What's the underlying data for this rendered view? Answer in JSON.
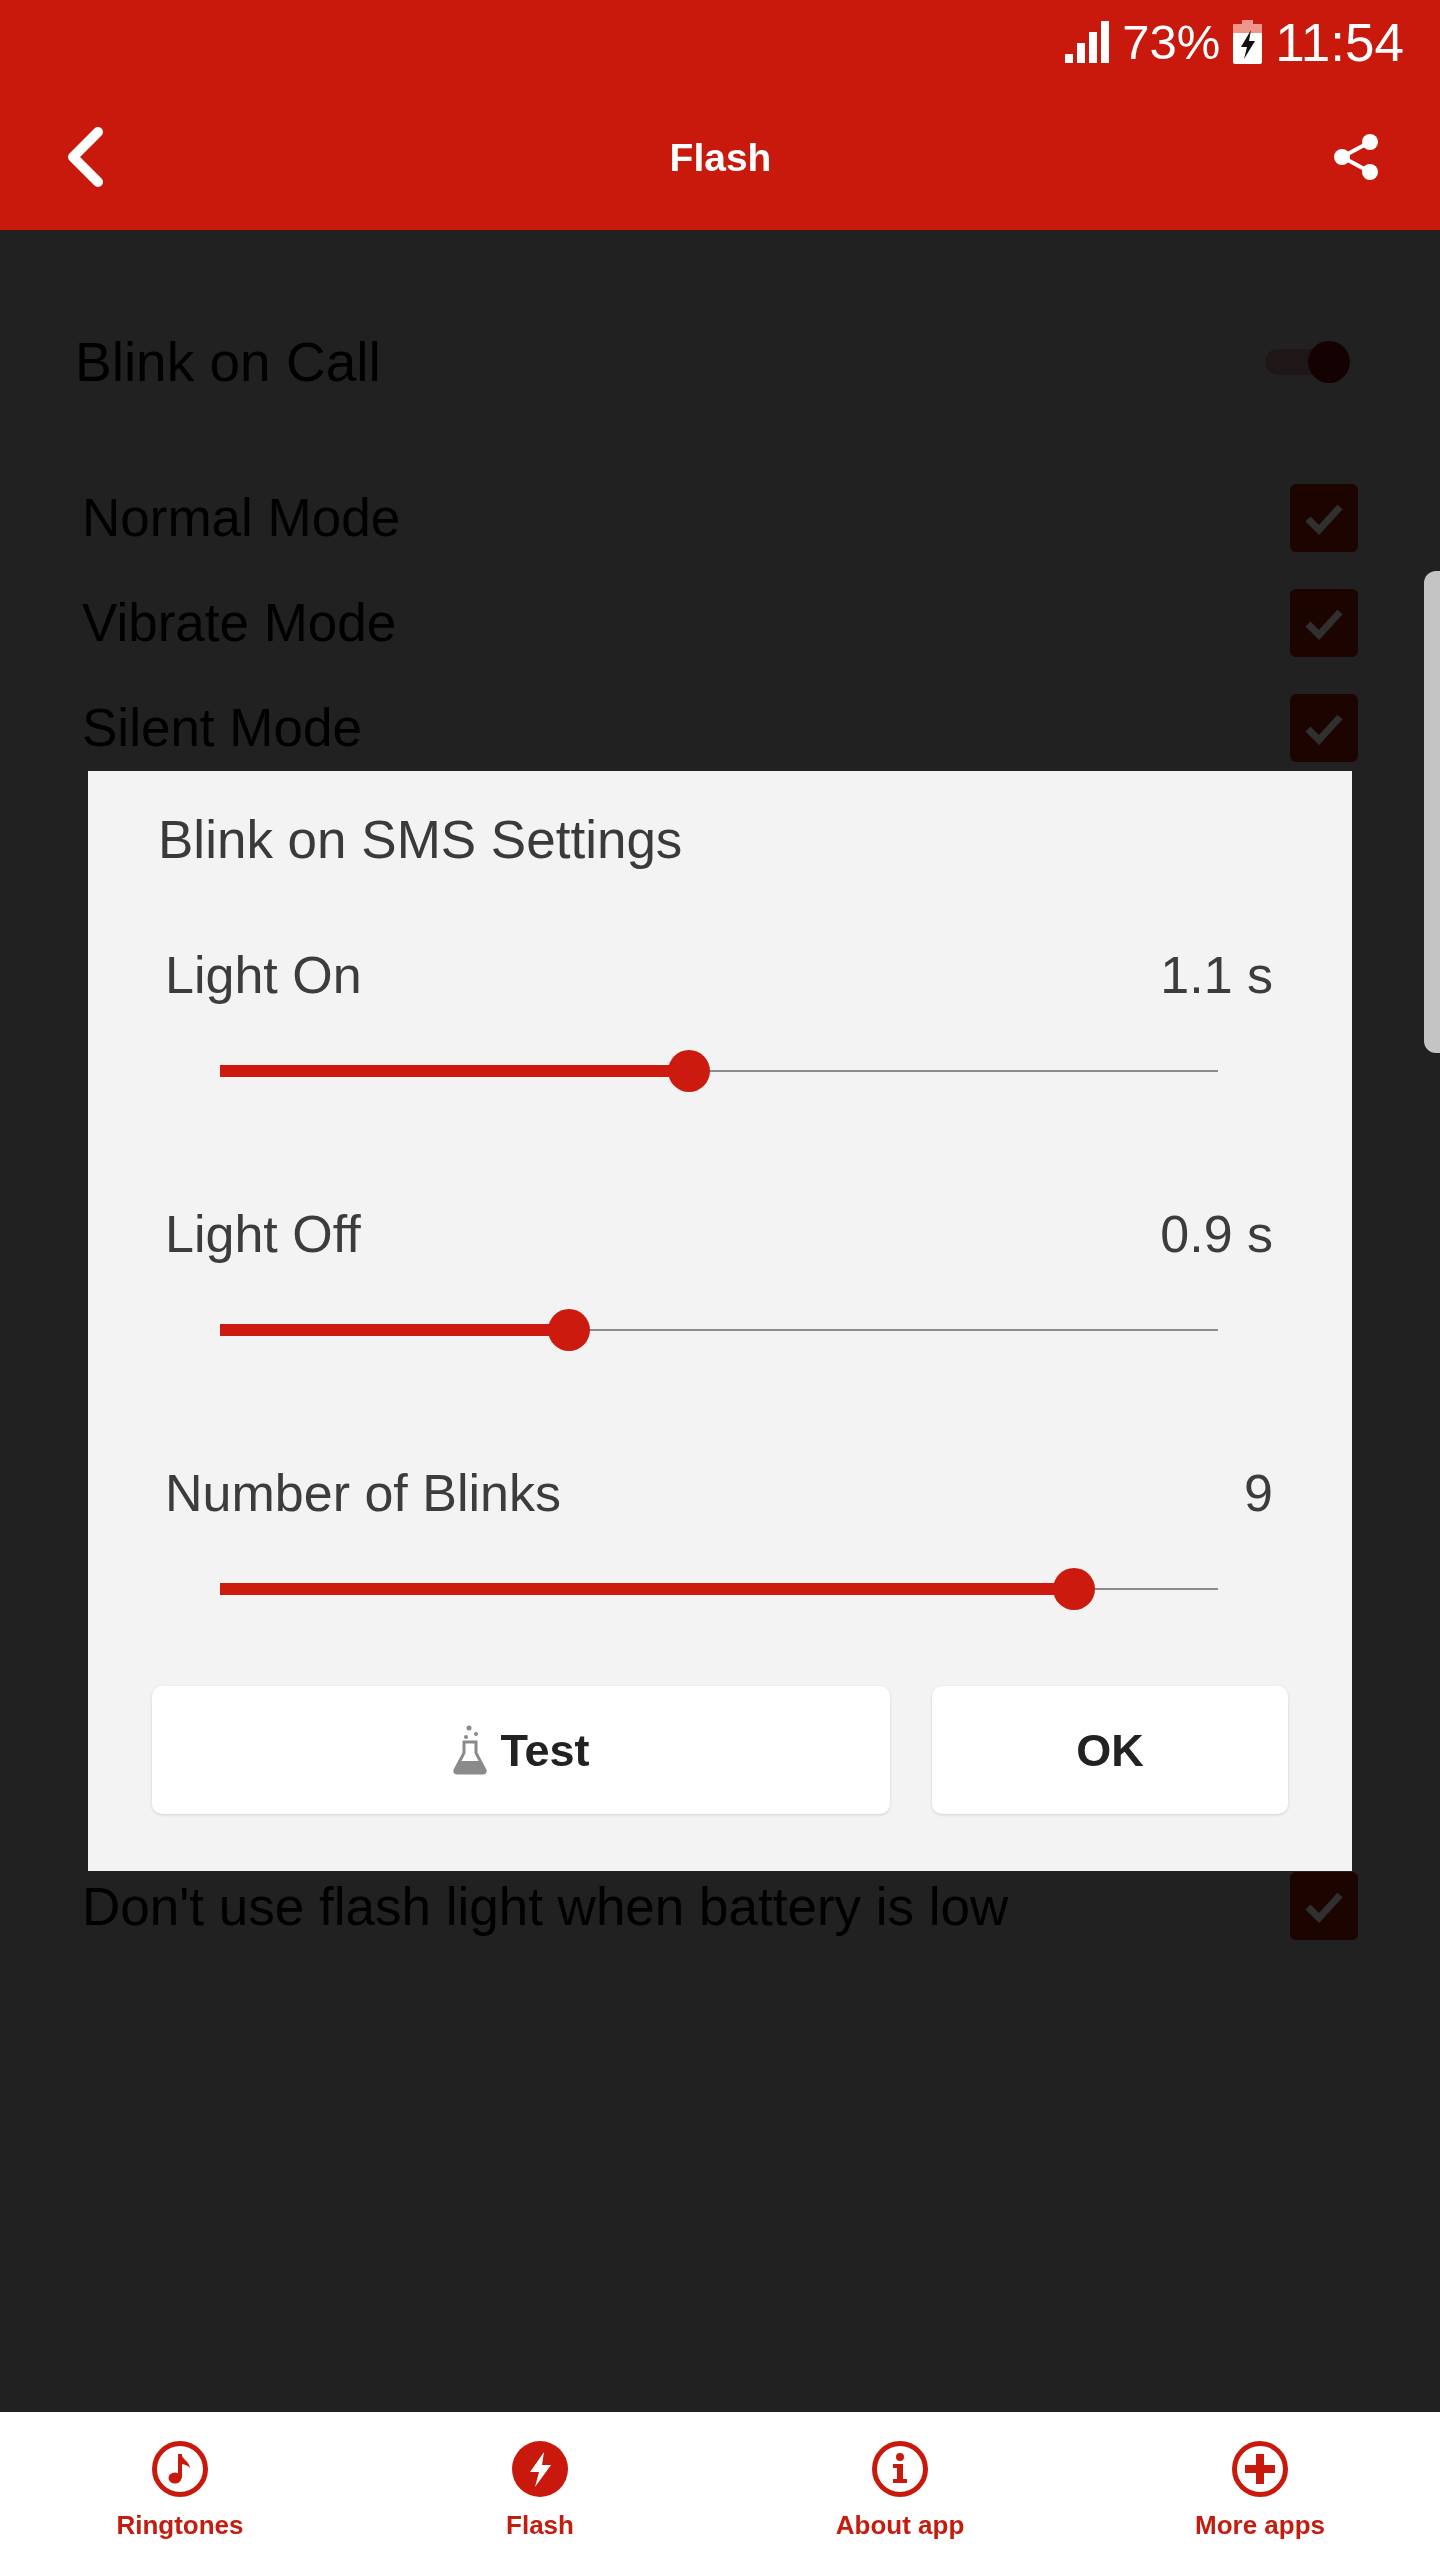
{
  "status_bar": {
    "battery": "73%",
    "time": "11:54"
  },
  "app_bar": {
    "title": "Flash"
  },
  "settings": {
    "blink_on_call": {
      "label": "Blink on Call",
      "on": true
    },
    "modes": [
      {
        "label": "Normal Mode",
        "checked": true
      },
      {
        "label": "Vibrate Mode",
        "checked": true
      },
      {
        "label": "Silent Mode",
        "checked": true
      }
    ],
    "low_battery": {
      "label": "Don't use flash light when battery is low",
      "checked": true
    }
  },
  "dialog": {
    "title": "Blink on SMS Settings",
    "settings": [
      {
        "label": "Light On",
        "value": "1.1 s",
        "level": 0.47
      },
      {
        "label": "Light Off",
        "value": "0.9 s",
        "level": 0.35
      },
      {
        "label": "Number of Blinks",
        "value": "9",
        "level": 0.856
      }
    ],
    "buttons": [
      {
        "label": "Test",
        "kind": "icon"
      },
      {
        "label": "OK",
        "kind": "plain"
      }
    ]
  },
  "bottom_nav": [
    {
      "label": "Ringtones",
      "selected": false
    },
    {
      "label": "Flash",
      "selected": true
    },
    {
      "label": "About app",
      "selected": false
    },
    {
      "label": "More apps",
      "selected": false
    }
  ]
}
